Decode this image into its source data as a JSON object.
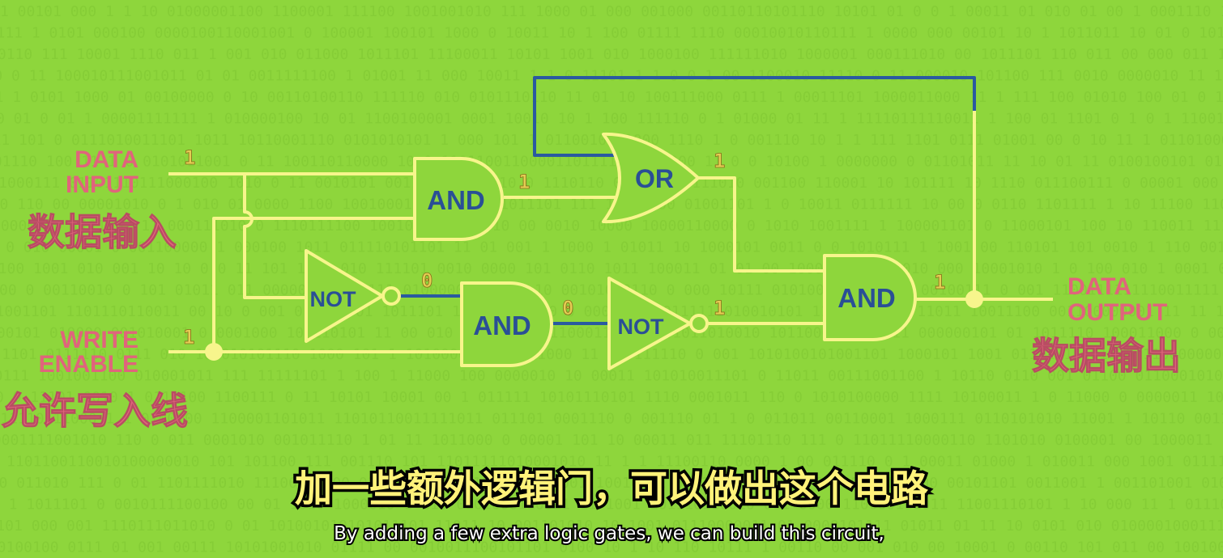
{
  "labels": {
    "data_input_line1": "DATA",
    "data_input_line2": "INPUT",
    "data_input_cn": "数据输入",
    "write_enable_line1": "WRITE",
    "write_enable_line2": "ENABLE",
    "write_enable_cn": "允许写入线",
    "data_output_line1": "DATA",
    "data_output_line2": "OUTPUT",
    "data_output_cn": "数据输出"
  },
  "gates": {
    "and_top": "AND",
    "or_gate": "OR",
    "not_top": "NOT",
    "and_middle": "AND",
    "not_middle": "NOT",
    "and_output": "AND"
  },
  "bits": {
    "data_input": "1",
    "write_enable": "1",
    "and_top_out": "1",
    "or_out": "1",
    "not_top_out": "0",
    "and_middle_out": "0",
    "not_middle_out": "1",
    "and_output_out": "1"
  },
  "subtitles": {
    "chinese": "加一些额外逻辑门，可以做出这个电路",
    "english": "By adding a few extra logic gates, we can build this circuit,"
  },
  "colors": {
    "background": "#8ed63c",
    "wire_active": "#f7f58c",
    "wire_inactive": "#2a5aa0",
    "label_pink": "#e0647c",
    "gate_text": "#2a4f96",
    "bit_yellow": "#e4cd53"
  }
}
